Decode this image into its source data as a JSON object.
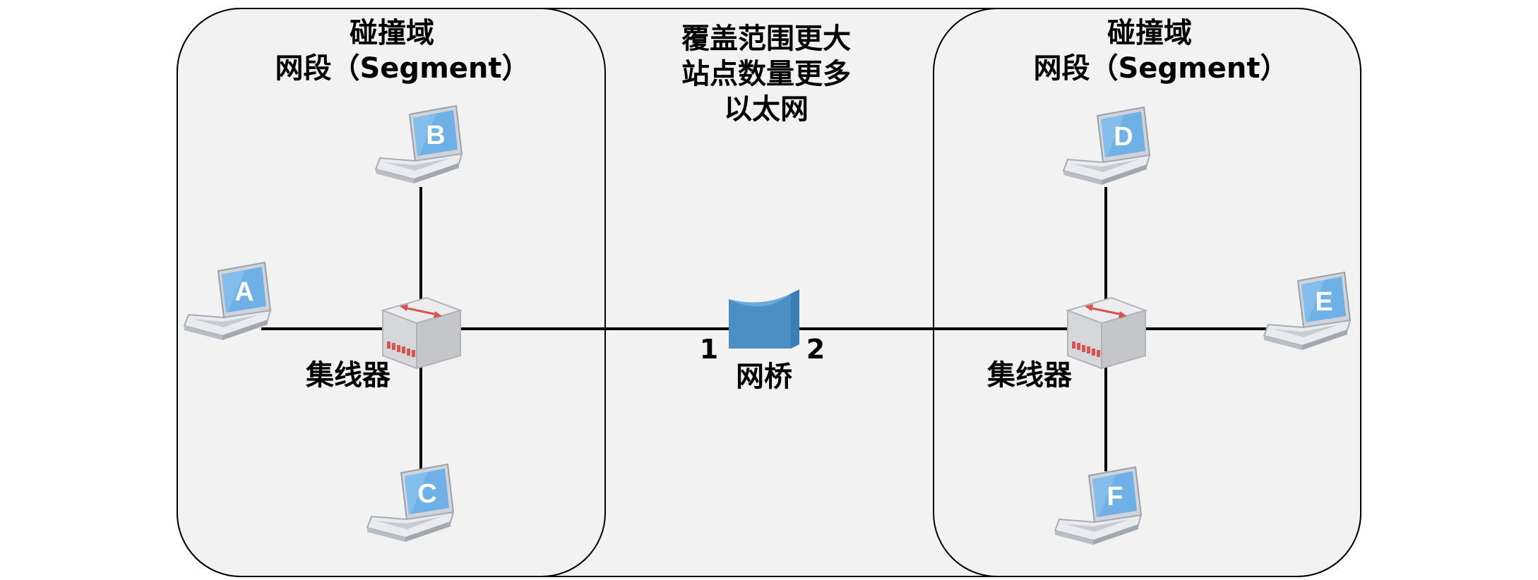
{
  "left_domain": {
    "title_line1": "碰撞域",
    "title_line2": "网段（Segment）",
    "hub_label": "集线器",
    "laptops": [
      "A",
      "B",
      "C"
    ]
  },
  "right_domain": {
    "title_line1": "碰撞域",
    "title_line2": "网段（Segment）",
    "hub_label": "集线器",
    "laptops": [
      "D",
      "E",
      "F"
    ]
  },
  "center": {
    "lines": [
      "覆盖范围更大",
      "站点数量更多",
      "以太网"
    ],
    "bridge_label": "网桥",
    "port_left": "1",
    "port_right": "2"
  },
  "colors": {
    "background_panel": "#f2f2f2",
    "border": "#000000",
    "bridge_blue": "#4a90c4",
    "laptop_screen": "#6fb0e6",
    "hub_body": "#d9d9db",
    "hub_ports": "#d9534f"
  }
}
